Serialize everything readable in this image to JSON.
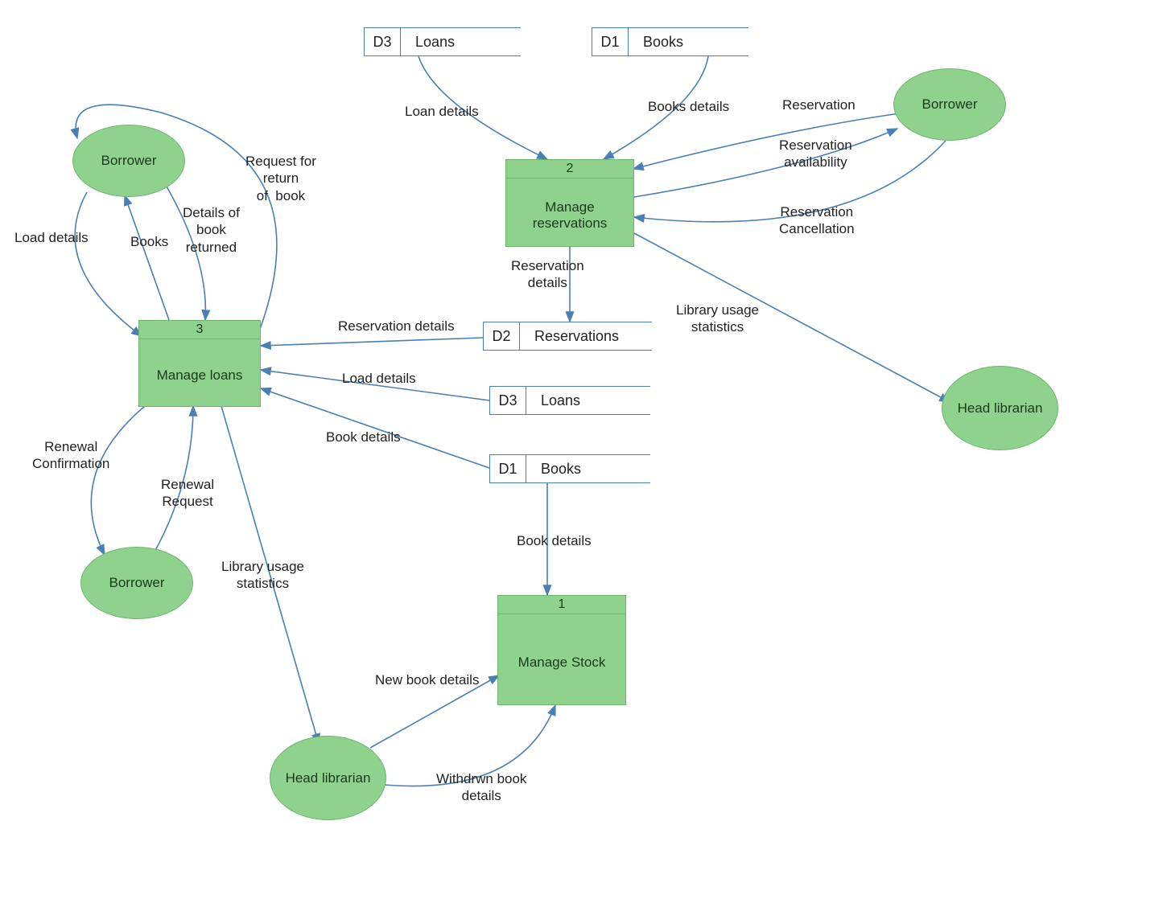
{
  "entities": {
    "borrower1": "Borrower",
    "borrower2": "Borrower",
    "borrower3": "Borrower",
    "headlib1": "Head librarian",
    "headlib2": "Head librarian"
  },
  "processes": {
    "p1": {
      "num": "1",
      "title": "Manage Stock"
    },
    "p2": {
      "num": "2",
      "title": "Manage reservations"
    },
    "p3": {
      "num": "3",
      "title": "Manage loans"
    }
  },
  "datastores": {
    "d3a": {
      "id": "D3",
      "name": "Loans"
    },
    "d1a": {
      "id": "D1",
      "name": "Books"
    },
    "d2": {
      "id": "D2",
      "name": "Reservations"
    },
    "d3b": {
      "id": "D3",
      "name": "Loans"
    },
    "d1b": {
      "id": "D1",
      "name": "Books"
    }
  },
  "flows": {
    "f1": "Loan details",
    "f2": "Books details",
    "f3": "Reservation",
    "f4": "Reservation\navailability",
    "f5": "Reservation\nCancellation",
    "f6": "Reservation\ndetails",
    "f7": "Library usage\nstatistics",
    "f8": "Reservation details",
    "f9": "Load details",
    "f10": "Book details",
    "f11": "Load details",
    "f12": "Books",
    "f13": "Details of\nbook\nreturned",
    "f14": "Request for\nreturn\nof  book",
    "f15": "Renewal\nConfirmation",
    "f16": "Renewal\nRequest",
    "f17": "Library usage\nstatistics",
    "f18": "Book details",
    "f19": "New book details",
    "f20": "Withdrwn book\ndetails"
  }
}
